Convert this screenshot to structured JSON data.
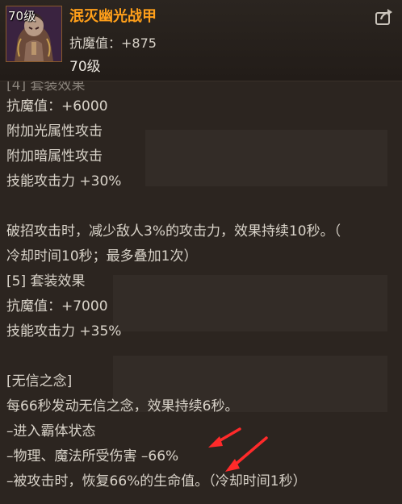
{
  "item": {
    "level_badge": "70级",
    "name": "泯灭幽光战甲",
    "stat": "抗魔值：+875",
    "level": "70级"
  },
  "body_lines": [
    "抗魔值：+6000",
    "附加光属性攻击",
    "附加暗属性攻击",
    "技能攻击力 +30%",
    "",
    "破招攻击时，减少敌人3%的攻击力，效果持续10秒。（",
    "冷却时间10秒；最多叠加1次）",
    "[5] 套装效果",
    "抗魔值：+7000",
    "技能攻击力 +35%",
    "",
    "[无信之念]",
    "每66秒发动无信之念，效果持续6秒。",
    "–进入霸体状态",
    "–物理、魔法所受伤害 –66%",
    "–被攻击时，恢复66%的生命值。（冷却时间1秒）"
  ],
  "colors": {
    "item_name": "#ff9f1a",
    "text": "#d9d3c9",
    "arrow": "#ff2a2a",
    "background": "#2c2520"
  },
  "icons": {
    "item": "armor-portrait-icon",
    "share": "share-icon",
    "annotation": "red-arrow-icon"
  }
}
